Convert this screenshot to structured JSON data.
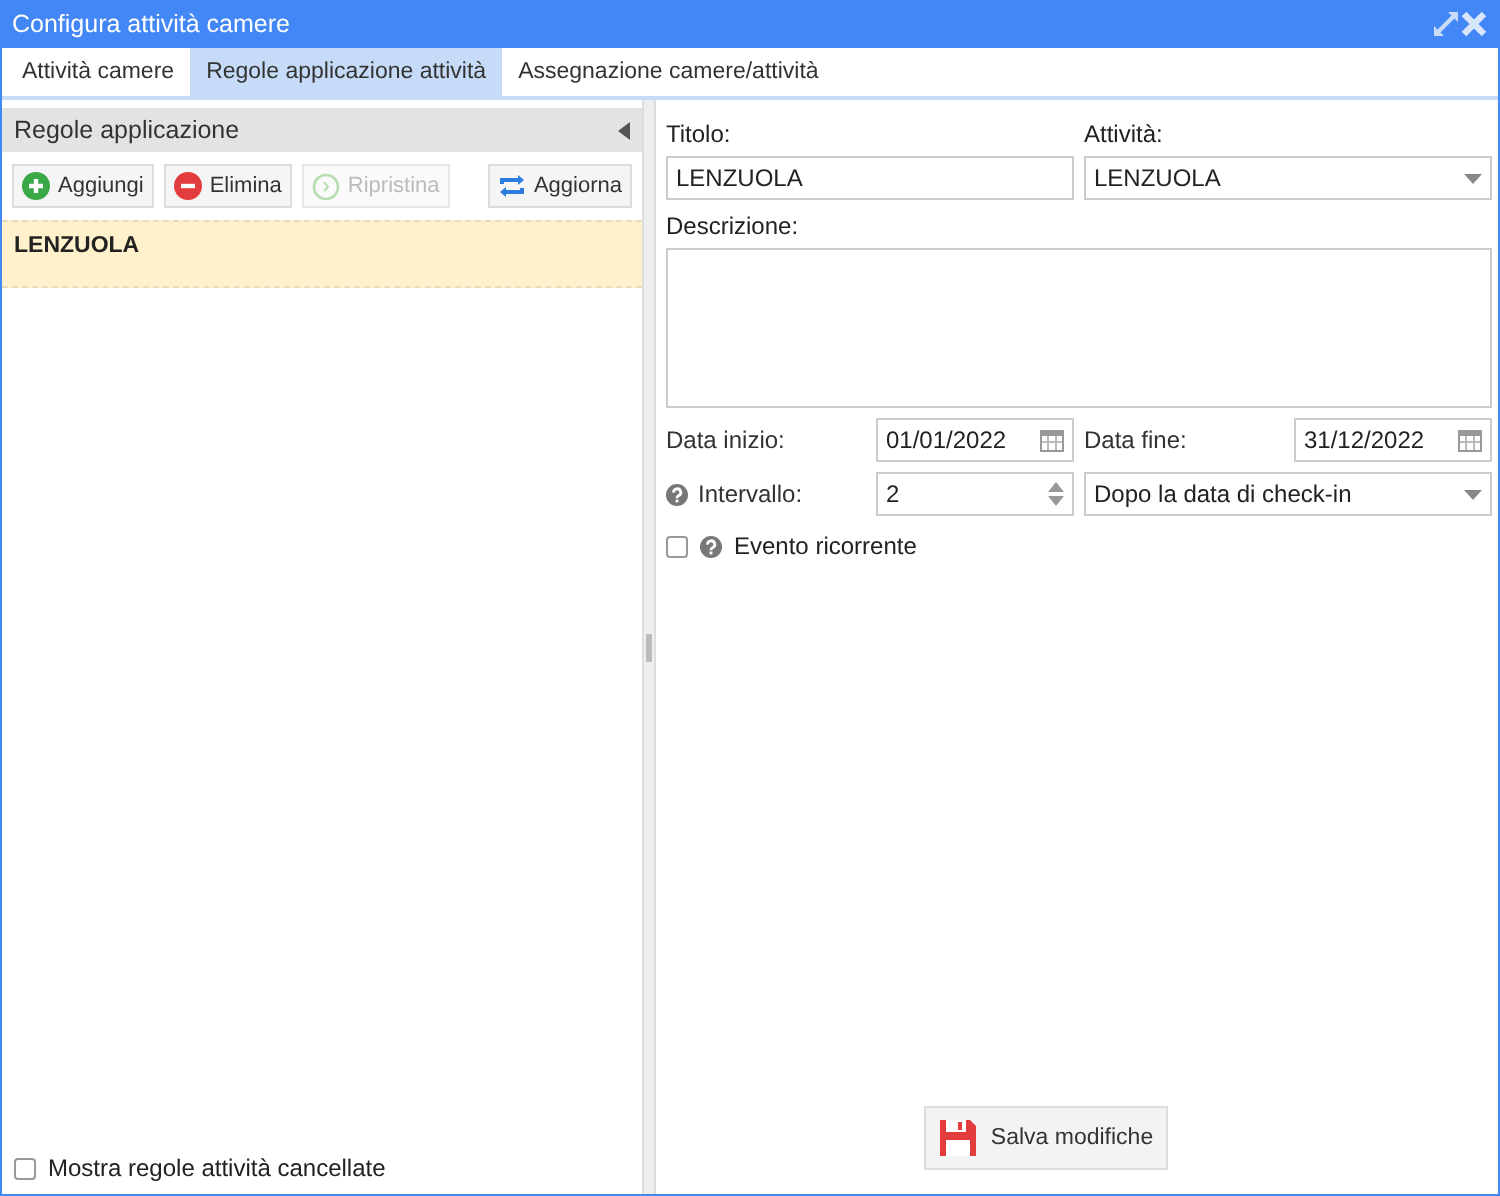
{
  "window": {
    "title": "Configura attività camere"
  },
  "tabs": [
    {
      "label": "Attività camere",
      "selected": false
    },
    {
      "label": "Regole applicazione attività",
      "selected": true
    },
    {
      "label": "Assegnazione camere/attività",
      "selected": false
    }
  ],
  "rules_panel": {
    "title": "Regole applicazione",
    "buttons": [
      {
        "label": "Aggiungi",
        "kind": "add",
        "disabled": false
      },
      {
        "label": "Elimina",
        "kind": "delete",
        "disabled": false
      },
      {
        "label": "Ripristina",
        "kind": "restore",
        "disabled": true
      },
      {
        "label": "Aggiorna",
        "kind": "refresh",
        "disabled": false
      }
    ],
    "items": [
      {
        "label": "LENZUOLA",
        "selected": true
      }
    ],
    "show_deleted": {
      "label": "Mostra regole attività cancellate",
      "checked": false
    }
  },
  "form": {
    "title": {
      "label": "Titolo:",
      "value": "LENZUOLA"
    },
    "activity": {
      "label": "Attività:",
      "value": "LENZUOLA"
    },
    "description": {
      "label": "Descrizione:"
    },
    "start_date": {
      "label": "Data inizio:",
      "value": "01/01/2022"
    },
    "end_date": {
      "label": "Data fine:",
      "value": "31/12/2022"
    },
    "interval": {
      "label": "Intervallo:",
      "value": "2",
      "mode": "Dopo la data di check-in"
    },
    "recurring": {
      "label": "Evento ricorrente",
      "checked": false
    },
    "save_button": "Salva modifiche"
  }
}
